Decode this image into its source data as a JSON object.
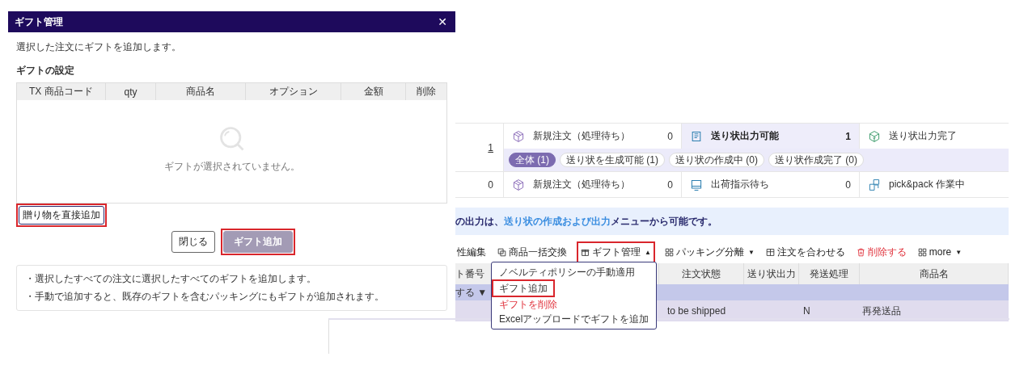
{
  "dialog": {
    "title": "ギフト管理",
    "close": "✕",
    "description": "選択した注文にギフトを追加します。",
    "section_title": "ギフトの設定",
    "table": {
      "columns": [
        "TX 商品コード",
        "qty",
        "商品名",
        "オプション",
        "金額",
        "削除"
      ],
      "empty_text": "ギフトが選択されていません。"
    },
    "direct_add_button": {
      "label": "贈り物を直接追加",
      "highlighted": true
    },
    "buttons": [
      {
        "label": "閉じる",
        "kind": "secondary",
        "highlighted": false
      },
      {
        "label": "ギフト追加",
        "kind": "primary",
        "highlighted": true
      }
    ],
    "notes": [
      "・選択したすべての注文に選択したすべてのギフトを追加します。",
      "・手動で追加すると、既存のギフトを含むパッキングにもギフトが追加されます。"
    ]
  },
  "background": {
    "status_rows": [
      {
        "count": "1",
        "linked": true,
        "cells": [
          {
            "label": "新規注文（処理待ち）",
            "count": "0",
            "selected": false
          },
          {
            "label": "送り状出力可能",
            "count": "1",
            "selected": true
          },
          {
            "label": "送り状出力完了",
            "selected": false
          }
        ],
        "chips": [
          {
            "label": "全体 (1)",
            "selected": true
          },
          {
            "label": "送り状を生成可能 (1)",
            "selected": false
          },
          {
            "label": "送り状の作成中 (0)",
            "selected": false
          },
          {
            "label": "送り状作成完了 (0)",
            "selected": false
          }
        ]
      },
      {
        "count": "0",
        "linked": false,
        "cells": [
          {
            "label": "新規注文（処理待ち）",
            "count": "0",
            "selected": false
          },
          {
            "label": "出荷指示待ち",
            "count": "0",
            "selected": false
          },
          {
            "label": "pick&pack 作業中",
            "selected": false
          }
        ]
      }
    ],
    "banner": {
      "text_before": "の出力は、",
      "link": "送り状の作成および出力",
      "text_after": "メニューから可能です。"
    },
    "toolbar": [
      {
        "label": "性編集",
        "kind": "normal",
        "highlighted": false
      },
      {
        "label": "商品一括交換",
        "kind": "normal",
        "highlighted": false
      },
      {
        "label": "ギフト管理",
        "caret": "▲",
        "kind": "normal",
        "highlighted": true
      },
      {
        "label": "パッキング分離",
        "caret": "▼",
        "kind": "normal",
        "highlighted": false
      },
      {
        "label": "注文を合わせる",
        "kind": "normal",
        "highlighted": false
      },
      {
        "label": "削除する",
        "kind": "danger",
        "highlighted": false
      },
      {
        "label": "more",
        "caret": "▼",
        "kind": "normal",
        "highlighted": false
      }
    ],
    "table": {
      "columns": [
        "ト番号",
        "",
        "注文状態",
        "送り状出力",
        "発送処理",
        "商品名"
      ],
      "group_row": "する ▼",
      "rows": [
        [
          "",
          "",
          "to be shipped",
          "",
          "N",
          "再発送品"
        ]
      ]
    },
    "menu": [
      {
        "label": "ノベルティポリシーの手動適用",
        "kind": "normal",
        "highlighted": false
      },
      {
        "label": "ギフト追加",
        "kind": "normal",
        "highlighted": true
      },
      {
        "label": "ギフトを削除",
        "kind": "danger",
        "highlighted": false
      },
      {
        "label": "Excelアップロードでギフトを追加",
        "kind": "normal",
        "highlighted": false
      }
    ]
  }
}
